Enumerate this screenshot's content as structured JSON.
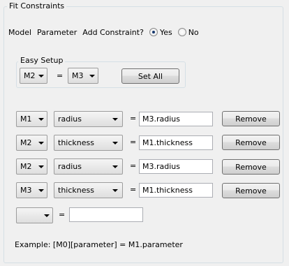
{
  "group": {
    "title": "Fit Constraints"
  },
  "top_row": {
    "model_label": "Model",
    "parameter_label": "Parameter",
    "add_constraint_label": "Add Constraint?",
    "yes_label": "Yes",
    "no_label": "No",
    "selected": "Yes"
  },
  "easy_setup": {
    "title": "Easy Setup",
    "left_model": "M2",
    "equals": "=",
    "right_model": "M3",
    "set_all_label": "Set All"
  },
  "constraints": [
    {
      "model": "M1",
      "parameter": "radius",
      "equals": "=",
      "value": "M3.radius",
      "remove_label": "Remove"
    },
    {
      "model": "M2",
      "parameter": "thickness",
      "equals": "=",
      "value": "M1.thickness",
      "remove_label": "Remove"
    },
    {
      "model": "M2",
      "parameter": "radius",
      "equals": "=",
      "value": "M3.radius",
      "remove_label": "Remove"
    },
    {
      "model": "M3",
      "parameter": "thickness",
      "equals": "=",
      "value": "M1.thickness",
      "remove_label": "Remove"
    }
  ],
  "empty_row": {
    "model": "",
    "equals": "=",
    "value": ""
  },
  "example_text": "Example: [M0][parameter] = M1.parameter",
  "icons": {
    "dropdown": "chevron-down-icon",
    "radio": "radio-button-icon"
  }
}
